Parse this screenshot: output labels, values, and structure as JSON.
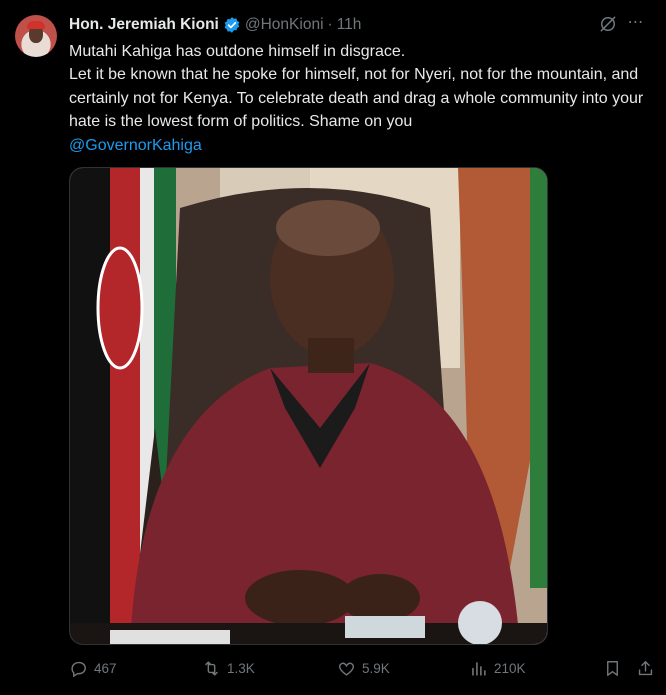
{
  "tweet": {
    "author_name": "Hon. Jeremiah Kioni",
    "handle": "@HonKioni",
    "separator": "·",
    "time": "11h",
    "line1": "Mutahi Kahiga has outdone himself in disgrace.",
    "line2": "Let it be known that he spoke for himself, not for Nyeri, not for the mountain, and certainly not for Kenya. To celebrate death and drag a whole community into your hate is the lowest form of politics. Shame on you",
    "mention": "@GovernorKahiga"
  },
  "metrics": {
    "replies": "467",
    "reposts": "1.3K",
    "likes": "5.9K",
    "views": "210K"
  },
  "colors": {
    "accent": "#1d9bf0",
    "muted": "#71767b",
    "text": "#e7e9ea",
    "background": "#000000"
  },
  "icons": [
    "verified-badge-icon",
    "grok-icon",
    "more-icon",
    "reply-icon",
    "repost-icon",
    "like-icon",
    "views-icon",
    "bookmark-icon",
    "share-icon"
  ]
}
